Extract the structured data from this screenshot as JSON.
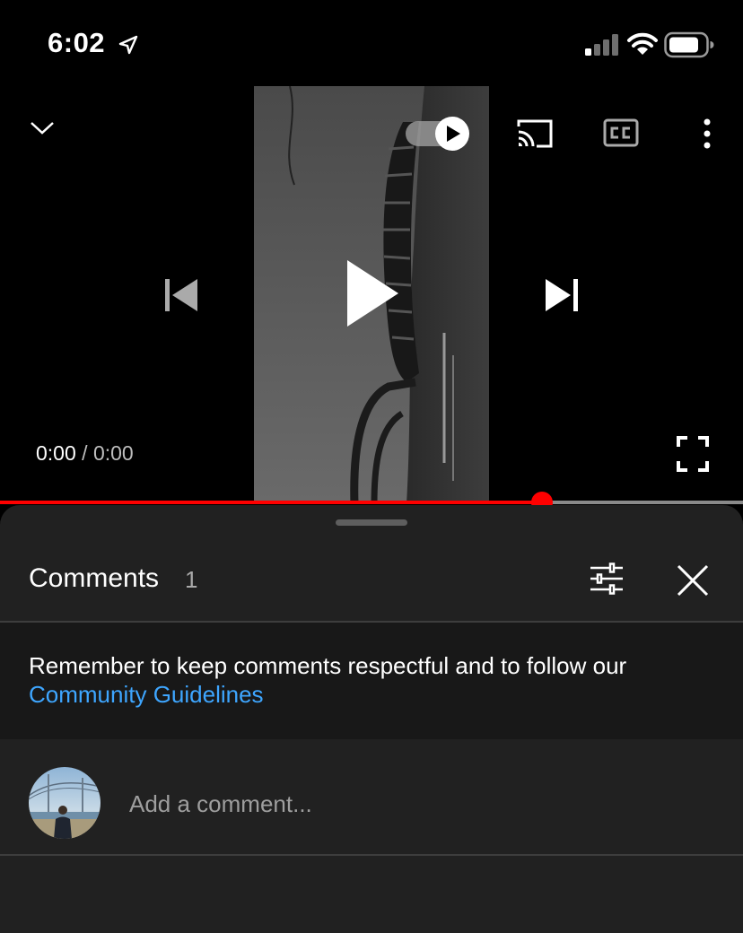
{
  "status_bar": {
    "time": "6:02",
    "icons": [
      "location-arrow-icon",
      "cellular-signal-icon",
      "wifi-icon",
      "battery-icon"
    ]
  },
  "player": {
    "icons": [
      "chevron-down-icon",
      "autoplay-toggle-icon",
      "cast-icon",
      "closed-captions-icon",
      "more-vert-icon",
      "skip-previous-icon",
      "play-icon",
      "skip-next-icon",
      "fullscreen-icon"
    ],
    "current_time": "0:00",
    "separator": "/",
    "total_time": "0:00",
    "progress_fraction": 0.73,
    "colors": {
      "progress": "#ff0000",
      "track": "#8a8a8a"
    }
  },
  "comments_panel": {
    "title": "Comments",
    "count": "1",
    "notice_text": "Remember to keep comments respectful and to follow our",
    "notice_link": "Community Guidelines",
    "input_placeholder": "Add a comment...",
    "icons": [
      "filter-sliders-icon",
      "close-icon"
    ],
    "colors": {
      "background": "#212121",
      "link": "#3ea6ff"
    }
  }
}
